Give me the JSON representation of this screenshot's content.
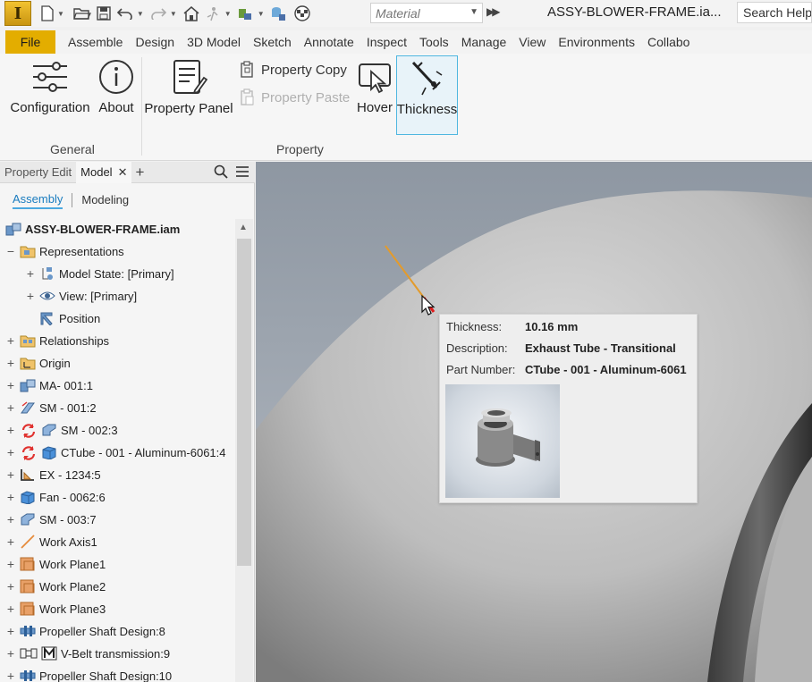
{
  "qat": {
    "material_placeholder": "Material",
    "doc_title": "ASSY-BLOWER-FRAME.ia...",
    "search_help": "Search Help"
  },
  "tabs": [
    "File",
    "Assemble",
    "Design",
    "3D Model",
    "Sketch",
    "Annotate",
    "Inspect",
    "Tools",
    "Manage",
    "View",
    "Environments",
    "Collabo"
  ],
  "ribbon": {
    "general": {
      "label": "General",
      "configuration": "Configuration",
      "about": "About"
    },
    "property": {
      "label": "Property",
      "property_panel": "Property Panel",
      "property_copy": "Property Copy",
      "property_paste": "Property Paste",
      "hover": "Hover",
      "thickness": "Thickness"
    }
  },
  "browser": {
    "tabs": {
      "property_edit": "Property Edit",
      "model": "Model"
    },
    "modes": {
      "assembly": "Assembly",
      "modeling": "Modeling"
    },
    "tree": [
      {
        "label": "ASSY-BLOWER-FRAME.iam",
        "icon": "assembly-icon"
      },
      {
        "label": "Representations",
        "icon": "representations-folder-icon"
      },
      {
        "label": "Model State: [Primary]",
        "icon": "model-state-icon"
      },
      {
        "label": "View: [Primary]",
        "icon": "view-eye-icon"
      },
      {
        "label": "Position",
        "icon": "position-icon"
      },
      {
        "label": "Relationships",
        "icon": "relationships-folder-icon"
      },
      {
        "label": "Origin",
        "icon": "origin-folder-icon"
      },
      {
        "label": "MA- 001:1",
        "icon": "subassembly-icon"
      },
      {
        "label": "SM - 001:2",
        "icon": "sheet-metal-icon"
      },
      {
        "label": "SM - 002:3",
        "icon": "sheet-metal-icon"
      },
      {
        "label": "CTube - 001 - Aluminum-6061:4",
        "icon": "part-icon"
      },
      {
        "label": "EX - 1234:5",
        "icon": "frame-member-icon"
      },
      {
        "label": "Fan - 0062:6",
        "icon": "part-icon"
      },
      {
        "label": "SM - 003:7",
        "icon": "sheet-metal-icon"
      },
      {
        "label": "Work Axis1",
        "icon": "work-axis-icon"
      },
      {
        "label": "Work Plane1",
        "icon": "work-plane-icon"
      },
      {
        "label": "Work Plane2",
        "icon": "work-plane-icon"
      },
      {
        "label": "Work Plane3",
        "icon": "work-plane-icon"
      },
      {
        "label": "Propeller Shaft Design:8",
        "icon": "shaft-design-icon"
      },
      {
        "label": "V-Belt transmission:9",
        "icon": "vbelt-icon"
      },
      {
        "label": "Propeller Shaft Design:10",
        "icon": "shaft-design-icon"
      }
    ]
  },
  "tooltip": {
    "thickness_label": "Thickness:",
    "thickness_value": "10.16 mm",
    "description_label": "Description:",
    "description_value": "Exhaust Tube - Transitional",
    "part_number_label": "Part Number:",
    "part_number_value": "CTube - 001 - Aluminum-6061"
  },
  "colors": {
    "accent": "#4aa8e0",
    "file_tab": "#e3ad00",
    "measure_line": "#e39b2c",
    "measure_point": "#e01b1b"
  }
}
